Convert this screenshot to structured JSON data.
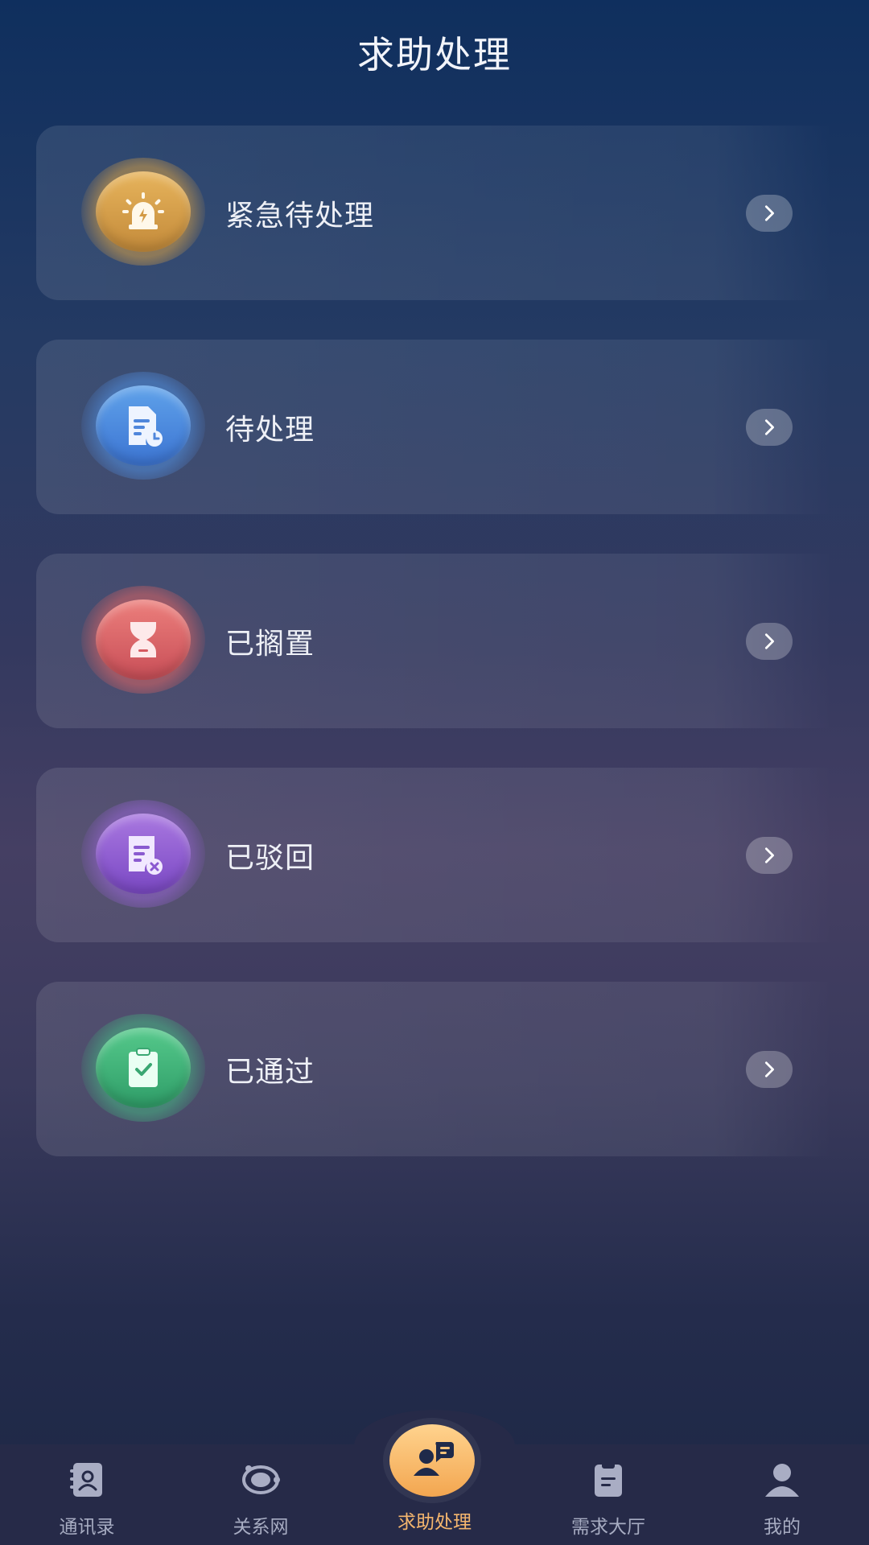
{
  "header": {
    "title": "求助处理"
  },
  "menu": [
    {
      "label": "紧急待处理",
      "icon": "alarm-light-icon",
      "color": "#d9a04c"
    },
    {
      "label": "待处理",
      "icon": "document-clock-icon",
      "color": "#4f8be0"
    },
    {
      "label": "已搁置",
      "icon": "hourglass-icon",
      "color": "#dc6568"
    },
    {
      "label": "已驳回",
      "icon": "document-reject-icon",
      "color": "#9060d4"
    },
    {
      "label": "已通过",
      "icon": "clipboard-check-icon",
      "color": "#43b57c"
    }
  ],
  "tabbar": {
    "items": [
      {
        "label": "通讯录",
        "icon": "contacts-book-icon"
      },
      {
        "label": "关系网",
        "icon": "orbit-network-icon"
      },
      {
        "label": "求助处理",
        "icon": "help-chat-user-icon",
        "active": true
      },
      {
        "label": "需求大厅",
        "icon": "clipboard-list-icon"
      },
      {
        "label": "我的",
        "icon": "user-profile-icon"
      }
    ],
    "active_color": "#f5b66e"
  }
}
